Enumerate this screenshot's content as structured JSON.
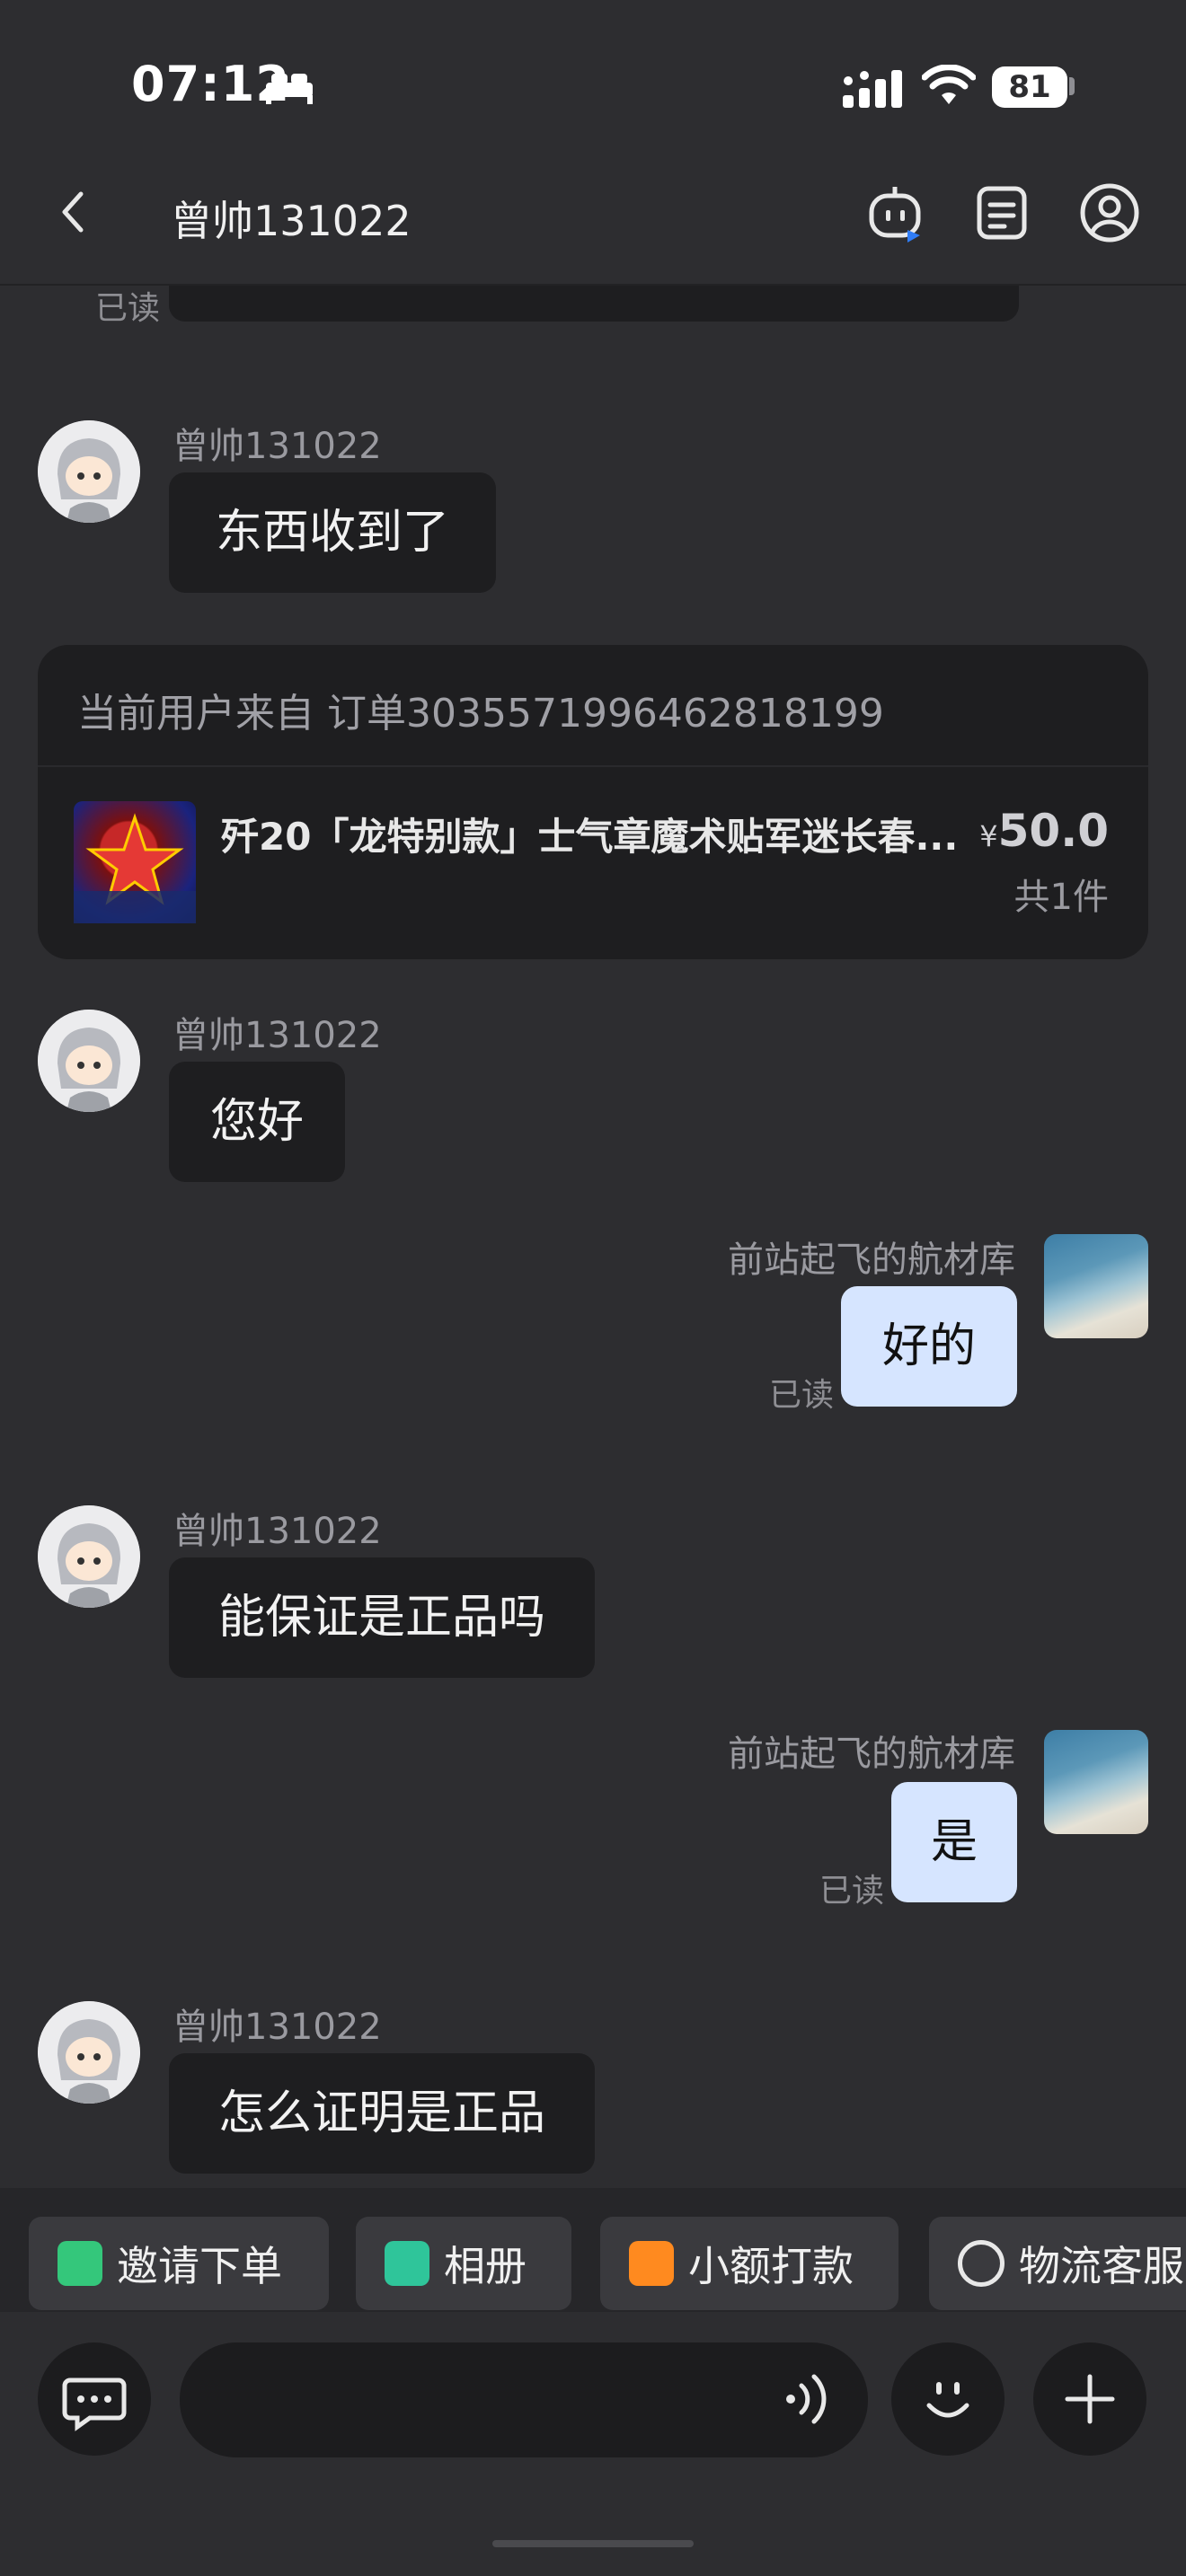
{
  "status": {
    "time": "07:12",
    "battery": "81"
  },
  "header": {
    "title": "曾帅131022"
  },
  "top_partial": {
    "read_label": "已读"
  },
  "messages": [
    {
      "sender": "曾帅131022",
      "text": "东西收到了"
    },
    {
      "sender": "曾帅131022",
      "text": "您好"
    },
    {
      "sender": "前站起飞的航材库",
      "text": "好的",
      "read": "已读"
    },
    {
      "sender": "曾帅131022",
      "text": "能保证是正品吗"
    },
    {
      "sender": "前站起飞的航材库",
      "text": "是",
      "read": "已读"
    },
    {
      "sender": "曾帅131022",
      "text": "怎么证明是正品"
    }
  ],
  "order_card": {
    "header": "当前用户来自 订单3035571996462818199",
    "product_name": "歼20「龙特别款」士气章魔术贴军迷长春...",
    "price_symbol": "¥",
    "price": "50.0",
    "quantity": "共1件"
  },
  "quick_actions": [
    {
      "label": "邀请下单",
      "icon": "invite-order-icon",
      "color": "#34c77b"
    },
    {
      "label": "相册",
      "icon": "album-icon",
      "color": "#2fc59a"
    },
    {
      "label": "小额打款",
      "icon": "payment-icon",
      "color": "#ff8a1f"
    },
    {
      "label": "物流客服",
      "icon": "logistics-service-icon",
      "color": "#1c1c1e"
    }
  ],
  "input": {
    "placeholder": ""
  }
}
